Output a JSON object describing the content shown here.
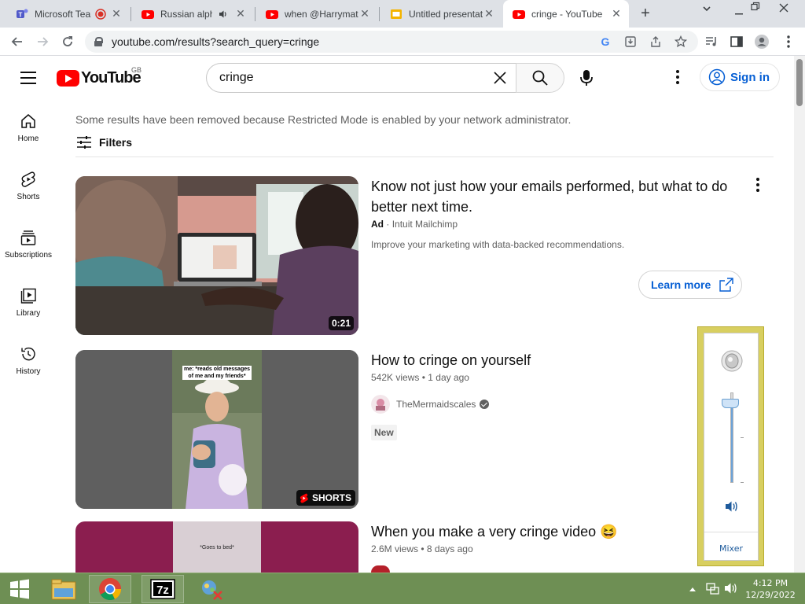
{
  "browser": {
    "tabs": [
      {
        "title": "Microsoft Teams",
        "favicon": "teams-icon",
        "recording": true
      },
      {
        "title": "Russian alpha",
        "favicon": "youtube-icon",
        "audio": true
      },
      {
        "title": "when @Harrymat",
        "favicon": "youtube-icon"
      },
      {
        "title": "Untitled presentation",
        "favicon": "slides-icon"
      },
      {
        "title": "cringe - YouTube",
        "favicon": "youtube-icon",
        "active": true
      }
    ],
    "url": "youtube.com/results?search_query=cringe"
  },
  "youtube": {
    "logo_text": "YouTube",
    "region": "GB",
    "search_value": "cringe",
    "signin_label": "Sign in",
    "guide": [
      {
        "label": "Home",
        "icon": "home-icon"
      },
      {
        "label": "Shorts",
        "icon": "shorts-icon"
      },
      {
        "label": "Subscriptions",
        "icon": "subscriptions-icon"
      },
      {
        "label": "Library",
        "icon": "library-icon"
      },
      {
        "label": "History",
        "icon": "history-icon"
      }
    ],
    "notice": "Some results have been removed because Restricted Mode is enabled by your network administrator.",
    "filters_label": "Filters",
    "ad": {
      "title": "Know not just how your emails performed, but what to do better next time.",
      "ad_label": "Ad",
      "advertiser": "Intuit Mailchimp",
      "description": "Improve your marketing with data-backed recommendations.",
      "duration": "0:21",
      "cta": "Learn more"
    },
    "results": [
      {
        "title": "How to cringe on yourself",
        "views": "542K views",
        "age": "1 day ago",
        "channel": "TheMermaidscales",
        "verified": true,
        "badge": "New",
        "overlay_label": "SHORTS",
        "thumb_caption": "me: *reads old messages of me and my friends*"
      },
      {
        "title": "When you make a very cringe video 😆",
        "views": "2.6M views",
        "age": "8 days ago",
        "thumb_caption": "*Goes to bed*"
      }
    ]
  },
  "volume": {
    "level": 0.88,
    "mixer_label": "Mixer"
  },
  "taskbar": {
    "time": "4:12 PM",
    "date": "12/29/2022"
  },
  "colors": {
    "youtube_red": "#ff0000",
    "link_blue": "#065fd4",
    "taskbar": "#6e8f54",
    "volume_frame": "#d8cf60"
  }
}
